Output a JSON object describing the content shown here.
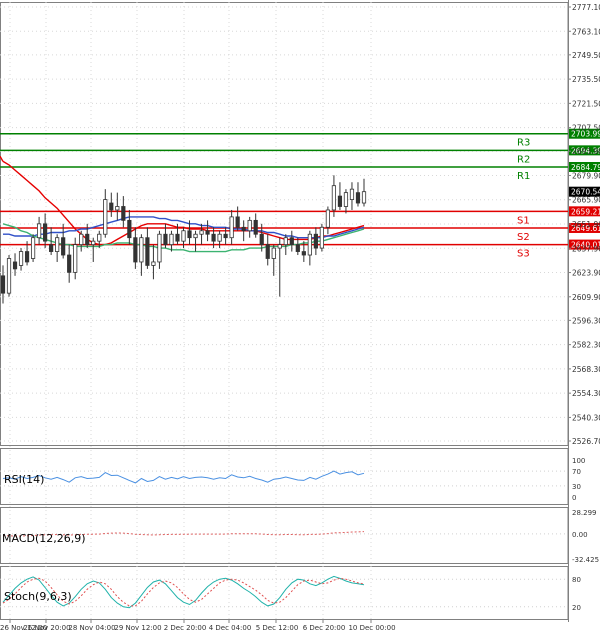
{
  "chart_data": {
    "type": "candlestick",
    "main": {
      "price_axis_ticks": [
        2777.1,
        2763.1,
        2749.5,
        2735.5,
        2721.5,
        2707.5,
        2693.9,
        2679.9,
        2665.9,
        2651.9,
        2637.9,
        2623.9,
        2609.9,
        2596.3,
        2582.3,
        2568.3,
        2554.3,
        2540.3,
        2526.7
      ],
      "current_price": 2670.54,
      "x_ticks": [
        "26 Nov 12:00",
        "26 Nov 20:00",
        "28 Nov 04:00",
        "29 Nov 12:00",
        "2 Dec 20:00",
        "4 Dec 04:00",
        "5 Dec 12:00",
        "6 Dec 20:00",
        "10 Dec 00:00"
      ],
      "levels": [
        {
          "name": "R3",
          "value": 2703.99,
          "color": "#008000"
        },
        {
          "name": "R2",
          "value": 2694.39,
          "color": "#008000"
        },
        {
          "name": "R1",
          "value": 2684.79,
          "color": "#008000"
        },
        {
          "name": "S1",
          "value": 2659.21,
          "color": "#e00000"
        },
        {
          "name": "S2",
          "value": 2649.61,
          "color": "#e00000"
        },
        {
          "name": "S3",
          "value": 2640.01,
          "color": "#e00000"
        }
      ],
      "candles": [
        {
          "o": 2622,
          "h": 2628,
          "l": 2606,
          "c": 2612
        },
        {
          "o": 2612,
          "h": 2634,
          "l": 2610,
          "c": 2632
        },
        {
          "o": 2630,
          "h": 2635,
          "l": 2622,
          "c": 2626
        },
        {
          "o": 2628,
          "h": 2638,
          "l": 2625,
          "c": 2636
        },
        {
          "o": 2636,
          "h": 2642,
          "l": 2628,
          "c": 2630
        },
        {
          "o": 2632,
          "h": 2646,
          "l": 2630,
          "c": 2644
        },
        {
          "o": 2644,
          "h": 2656,
          "l": 2640,
          "c": 2652
        },
        {
          "o": 2652,
          "h": 2658,
          "l": 2638,
          "c": 2642
        },
        {
          "o": 2640,
          "h": 2650,
          "l": 2634,
          "c": 2636
        },
        {
          "o": 2636,
          "h": 2646,
          "l": 2630,
          "c": 2644
        },
        {
          "o": 2644,
          "h": 2652,
          "l": 2632,
          "c": 2634
        },
        {
          "o": 2634,
          "h": 2640,
          "l": 2618,
          "c": 2624
        },
        {
          "o": 2624,
          "h": 2644,
          "l": 2620,
          "c": 2640
        },
        {
          "o": 2640,
          "h": 2648,
          "l": 2636,
          "c": 2646
        },
        {
          "o": 2646,
          "h": 2652,
          "l": 2638,
          "c": 2640
        },
        {
          "o": 2640,
          "h": 2644,
          "l": 2630,
          "c": 2642
        },
        {
          "o": 2642,
          "h": 2648,
          "l": 2638,
          "c": 2646
        },
        {
          "o": 2646,
          "h": 2672,
          "l": 2644,
          "c": 2666
        },
        {
          "o": 2664,
          "h": 2670,
          "l": 2656,
          "c": 2660
        },
        {
          "o": 2660,
          "h": 2670,
          "l": 2654,
          "c": 2662
        },
        {
          "o": 2662,
          "h": 2668,
          "l": 2650,
          "c": 2654
        },
        {
          "o": 2654,
          "h": 2660,
          "l": 2640,
          "c": 2644
        },
        {
          "o": 2644,
          "h": 2650,
          "l": 2626,
          "c": 2630
        },
        {
          "o": 2630,
          "h": 2646,
          "l": 2622,
          "c": 2644
        },
        {
          "o": 2644,
          "h": 2650,
          "l": 2626,
          "c": 2628
        },
        {
          "o": 2628,
          "h": 2640,
          "l": 2620,
          "c": 2630
        },
        {
          "o": 2630,
          "h": 2648,
          "l": 2626,
          "c": 2646
        },
        {
          "o": 2646,
          "h": 2652,
          "l": 2638,
          "c": 2640
        },
        {
          "o": 2640,
          "h": 2648,
          "l": 2636,
          "c": 2646
        },
        {
          "o": 2646,
          "h": 2652,
          "l": 2640,
          "c": 2642
        },
        {
          "o": 2642,
          "h": 2650,
          "l": 2638,
          "c": 2648
        },
        {
          "o": 2648,
          "h": 2654,
          "l": 2640,
          "c": 2644
        },
        {
          "o": 2644,
          "h": 2648,
          "l": 2636,
          "c": 2646
        },
        {
          "o": 2646,
          "h": 2652,
          "l": 2640,
          "c": 2648
        },
        {
          "o": 2648,
          "h": 2654,
          "l": 2642,
          "c": 2646
        },
        {
          "o": 2646,
          "h": 2650,
          "l": 2638,
          "c": 2642
        },
        {
          "o": 2642,
          "h": 2648,
          "l": 2638,
          "c": 2646
        },
        {
          "o": 2646,
          "h": 2650,
          "l": 2640,
          "c": 2644
        },
        {
          "o": 2644,
          "h": 2660,
          "l": 2640,
          "c": 2656
        },
        {
          "o": 2656,
          "h": 2662,
          "l": 2648,
          "c": 2650
        },
        {
          "o": 2650,
          "h": 2654,
          "l": 2642,
          "c": 2648
        },
        {
          "o": 2648,
          "h": 2656,
          "l": 2644,
          "c": 2654
        },
        {
          "o": 2654,
          "h": 2658,
          "l": 2644,
          "c": 2646
        },
        {
          "o": 2646,
          "h": 2652,
          "l": 2636,
          "c": 2640
        },
        {
          "o": 2640,
          "h": 2646,
          "l": 2628,
          "c": 2632
        },
        {
          "o": 2632,
          "h": 2640,
          "l": 2622,
          "c": 2638
        },
        {
          "o": 2638,
          "h": 2644,
          "l": 2610,
          "c": 2640
        },
        {
          "o": 2640,
          "h": 2646,
          "l": 2634,
          "c": 2644
        },
        {
          "o": 2644,
          "h": 2648,
          "l": 2636,
          "c": 2640
        },
        {
          "o": 2640,
          "h": 2644,
          "l": 2634,
          "c": 2636
        },
        {
          "o": 2636,
          "h": 2642,
          "l": 2630,
          "c": 2634
        },
        {
          "o": 2634,
          "h": 2648,
          "l": 2628,
          "c": 2646
        },
        {
          "o": 2646,
          "h": 2650,
          "l": 2634,
          "c": 2638
        },
        {
          "o": 2638,
          "h": 2652,
          "l": 2636,
          "c": 2650
        },
        {
          "o": 2650,
          "h": 2662,
          "l": 2646,
          "c": 2660
        },
        {
          "o": 2660,
          "h": 2680,
          "l": 2656,
          "c": 2674
        },
        {
          "o": 2668,
          "h": 2676,
          "l": 2660,
          "c": 2662
        },
        {
          "o": 2662,
          "h": 2672,
          "l": 2658,
          "c": 2670
        },
        {
          "o": 2666,
          "h": 2676,
          "l": 2660,
          "c": 2672
        },
        {
          "o": 2670,
          "h": 2676,
          "l": 2662,
          "c": 2664
        },
        {
          "o": 2664,
          "h": 2678,
          "l": 2662,
          "c": 2670.54
        }
      ],
      "ma_series": [
        {
          "color": "#e60000",
          "values": [
            2688,
            2686,
            2683,
            2680,
            2677,
            2674,
            2671,
            2667,
            2664,
            2661,
            2657,
            2653,
            2649,
            2646,
            2643,
            2641,
            2640,
            2640,
            2641,
            2643,
            2645,
            2647,
            2649,
            2651,
            2652,
            2652,
            2652,
            2652,
            2651,
            2650,
            2650,
            2649,
            2649,
            2649,
            2648,
            2648,
            2648,
            2648,
            2648,
            2648,
            2648,
            2648,
            2648,
            2647,
            2646,
            2645,
            2644,
            2643,
            2643,
            2643,
            2643,
            2643,
            2644,
            2645,
            2645,
            2646,
            2647,
            2648,
            2649,
            2650,
            2651
          ]
        },
        {
          "color": "#3050c8",
          "values": [
            2646,
            2646,
            2645,
            2645,
            2645,
            2645,
            2646,
            2646,
            2647,
            2647,
            2647,
            2648,
            2648,
            2649,
            2649,
            2650,
            2651,
            2652,
            2653,
            2654,
            2655,
            2656,
            2656,
            2656,
            2656,
            2656,
            2655,
            2655,
            2654,
            2654,
            2653,
            2652,
            2652,
            2651,
            2651,
            2650,
            2650,
            2650,
            2649,
            2649,
            2649,
            2648,
            2648,
            2648,
            2647,
            2647,
            2646,
            2645,
            2645,
            2644,
            2644,
            2644,
            2644,
            2644,
            2645,
            2645,
            2646,
            2647,
            2648,
            2649,
            2650
          ]
        },
        {
          "color": "#3cb371",
          "values": [
            2652,
            2651,
            2650,
            2648,
            2647,
            2645,
            2644,
            2643,
            2642,
            2641,
            2640,
            2640,
            2639,
            2639,
            2639,
            2639,
            2639,
            2640,
            2640,
            2641,
            2641,
            2641,
            2640,
            2640,
            2639,
            2639,
            2638,
            2638,
            2637,
            2637,
            2637,
            2636,
            2636,
            2636,
            2636,
            2636,
            2636,
            2636,
            2637,
            2637,
            2637,
            2638,
            2638,
            2638,
            2639,
            2639,
            2639,
            2639,
            2640,
            2640,
            2641,
            2641,
            2642,
            2642,
            2643,
            2644,
            2645,
            2646,
            2647,
            2648,
            2649
          ]
        }
      ]
    },
    "rsi": {
      "label": "RSI(14)",
      "ticks": [
        100,
        70,
        30,
        0
      ],
      "color": "#4a90e2",
      "values": [
        50,
        52,
        48,
        55,
        50,
        53,
        58,
        52,
        48,
        53,
        47,
        40,
        52,
        55,
        50,
        51,
        53,
        66,
        58,
        59,
        52,
        45,
        38,
        50,
        42,
        45,
        55,
        48,
        53,
        49,
        55,
        50,
        53,
        54,
        52,
        48,
        52,
        50,
        60,
        54,
        52,
        56,
        50,
        46,
        40,
        48,
        50,
        54,
        50,
        46,
        45,
        53,
        48,
        56,
        62,
        70,
        62,
        66,
        68,
        60,
        64
      ]
    },
    "macd": {
      "label": "MACD(12,26,9)",
      "ticks": [
        28.299,
        0.0,
        -32.425
      ],
      "color": "#e06060",
      "values": [
        -2.0,
        -2.5,
        -2.8,
        -2.6,
        -2.4,
        -2.0,
        -1.5,
        -1.2,
        -1.0,
        -0.8,
        -1.0,
        -1.5,
        -1.2,
        -0.8,
        -0.5,
        -0.4,
        -0.2,
        0.5,
        1.0,
        1.2,
        1.0,
        0.4,
        -0.5,
        -0.8,
        -1.2,
        -1.4,
        -1.0,
        -0.8,
        -0.6,
        -0.6,
        -0.4,
        -0.4,
        -0.3,
        -0.2,
        -0.2,
        -0.3,
        -0.2,
        -0.2,
        0.2,
        0.3,
        0.2,
        0.3,
        0.1,
        -0.3,
        -0.8,
        -1.0,
        -1.0,
        -0.8,
        -0.8,
        -1.0,
        -1.1,
        -0.7,
        -0.6,
        -0.2,
        0.4,
        1.3,
        1.6,
        2.0,
        2.4,
        2.6,
        3.0
      ]
    },
    "stoch": {
      "label": "Stoch(9,6,3)",
      "ticks": [
        80,
        20
      ],
      "k_color": "#20b2aa",
      "d_color": "#e05050",
      "k_values": [
        30,
        45,
        60,
        72,
        80,
        85,
        78,
        62,
        45,
        30,
        22,
        28,
        42,
        58,
        70,
        76,
        72,
        58,
        40,
        28,
        20,
        18,
        28,
        45,
        62,
        74,
        78,
        70,
        55,
        40,
        30,
        25,
        34,
        50,
        64,
        74,
        80,
        82,
        78,
        70,
        60,
        52,
        42,
        30,
        22,
        26,
        40,
        58,
        72,
        80,
        78,
        70,
        66,
        72,
        80,
        86,
        82,
        76,
        72,
        70,
        68
      ],
      "d_values": [
        28,
        36,
        48,
        62,
        74,
        80,
        82,
        76,
        62,
        46,
        32,
        26,
        32,
        44,
        58,
        68,
        74,
        70,
        58,
        42,
        30,
        22,
        22,
        32,
        48,
        62,
        72,
        76,
        72,
        62,
        48,
        36,
        30,
        36,
        48,
        60,
        72,
        78,
        80,
        78,
        72,
        64,
        56,
        46,
        34,
        28,
        30,
        40,
        54,
        68,
        76,
        78,
        74,
        70,
        72,
        78,
        82,
        80,
        76,
        72,
        70
      ]
    }
  }
}
